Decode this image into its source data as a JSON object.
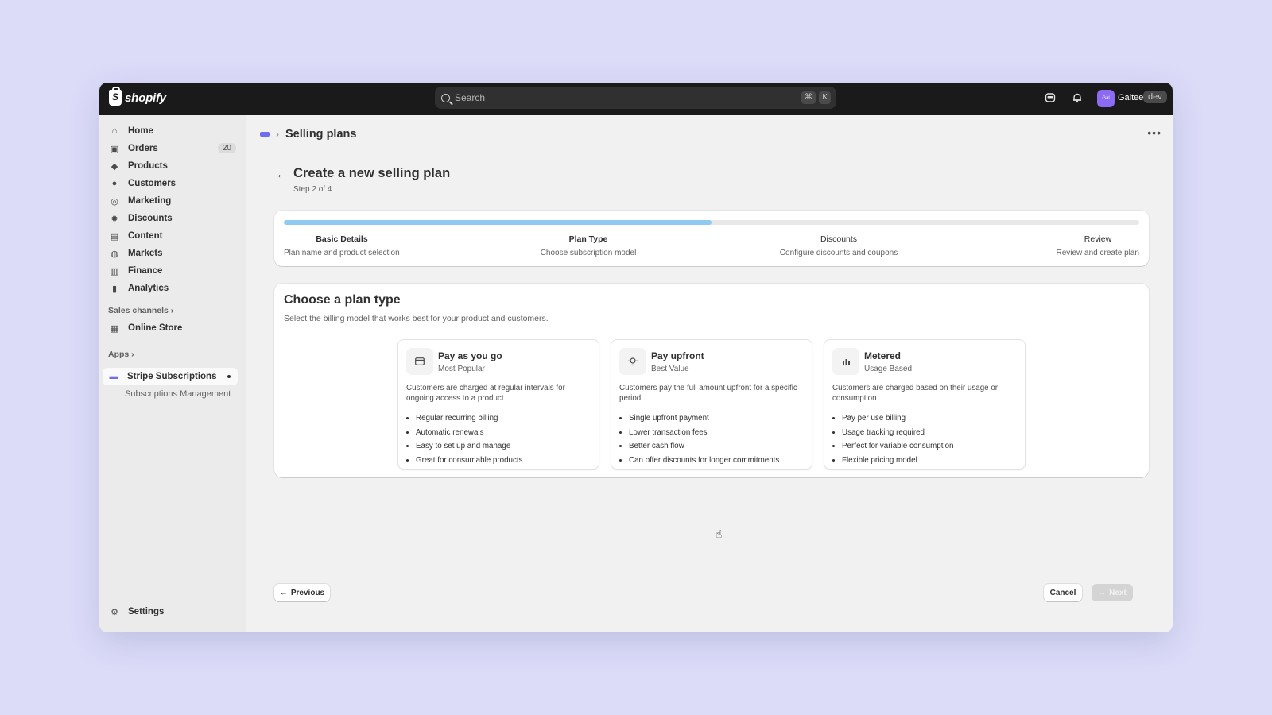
{
  "topbar": {
    "brand": "shopify",
    "search_placeholder": "Search",
    "shortcut_cmd": "⌘",
    "shortcut_key": "K",
    "avatar_initials": "Gal",
    "user_name": "Galtee",
    "badge": "dev"
  },
  "sidebar": {
    "items": [
      {
        "label": "Home",
        "icon": "home-icon"
      },
      {
        "label": "Orders",
        "icon": "orders-icon",
        "badge": "20"
      },
      {
        "label": "Products",
        "icon": "tag-icon"
      },
      {
        "label": "Customers",
        "icon": "person-icon"
      },
      {
        "label": "Marketing",
        "icon": "target-icon"
      },
      {
        "label": "Discounts",
        "icon": "discount-icon"
      },
      {
        "label": "Content",
        "icon": "content-icon"
      },
      {
        "label": "Markets",
        "icon": "globe-icon"
      },
      {
        "label": "Finance",
        "icon": "bank-icon"
      },
      {
        "label": "Analytics",
        "icon": "chart-icon"
      }
    ],
    "sales_channels_label": "Sales channels",
    "online_store": "Online Store",
    "apps_label": "Apps",
    "app_name": "Stripe Subscriptions",
    "app_sub": "Subscriptions Management",
    "settings": "Settings"
  },
  "header": {
    "breadcrumb_title": "Selling plans"
  },
  "page": {
    "title": "Create a new selling plan",
    "subtitle": "Step 2 of 4",
    "progress": 0.5
  },
  "steps": [
    {
      "title": "Basic Details",
      "desc": "Plan name and product selection"
    },
    {
      "title": "Plan Type",
      "desc": "Choose subscription model"
    },
    {
      "title": "Discounts",
      "desc": "Configure discounts and coupons"
    },
    {
      "title": "Review",
      "desc": "Review and create plan"
    }
  ],
  "plan": {
    "heading": "Choose a plan type",
    "description": "Select the billing model that works best for your product and customers.",
    "options": [
      {
        "title": "Pay as you go",
        "tag": "Most Popular",
        "icon": "credit-card-icon",
        "desc": "Customers are charged at regular intervals for ongoing access to a product",
        "features": [
          "Regular recurring billing",
          "Automatic renewals",
          "Easy to set up and manage",
          "Great for consumable products"
        ]
      },
      {
        "title": "Pay upfront",
        "tag": "Best Value",
        "icon": "lightbulb-icon",
        "desc": "Customers pay the full amount upfront for a specific period",
        "features": [
          "Single upfront payment",
          "Lower transaction fees",
          "Better cash flow",
          "Can offer discounts for longer commitments"
        ]
      },
      {
        "title": "Metered",
        "tag": "Usage Based",
        "icon": "bar-chart-icon",
        "desc": "Customers are charged based on their usage or consumption",
        "features": [
          "Pay per use billing",
          "Usage tracking required",
          "Perfect for variable consumption",
          "Flexible pricing model"
        ]
      }
    ]
  },
  "footer": {
    "previous": "Previous",
    "cancel": "Cancel",
    "next": "Next"
  }
}
